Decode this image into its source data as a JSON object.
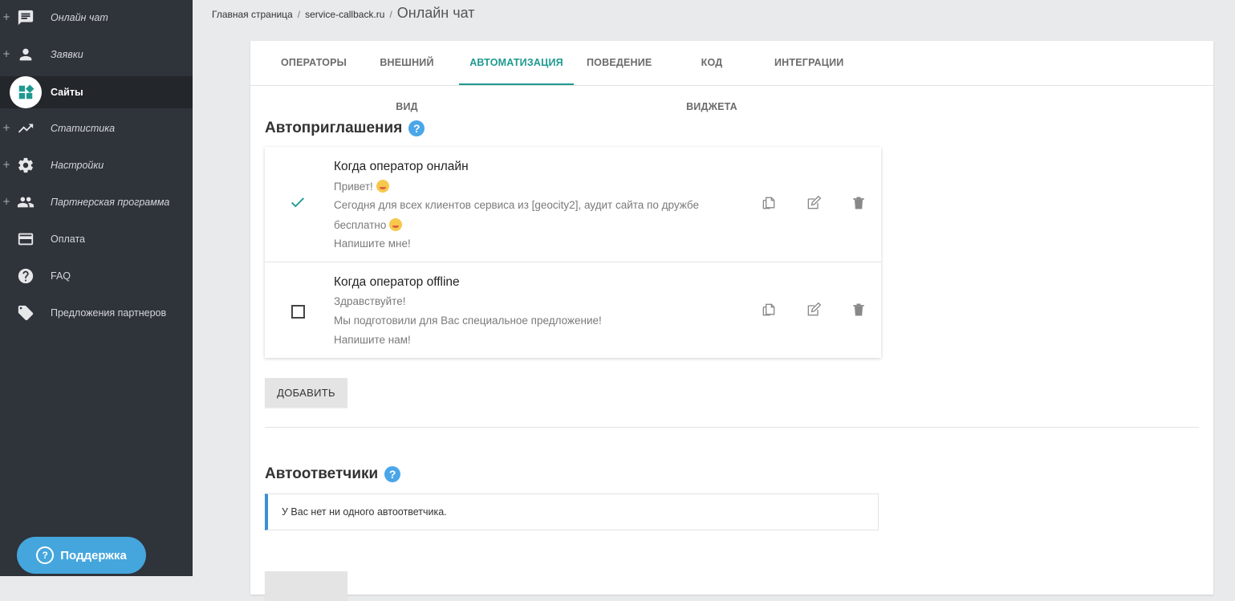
{
  "sidebar": {
    "items": [
      {
        "label": "Онлайн чат",
        "icon": "chat-icon",
        "expandable": "+"
      },
      {
        "label": "Заявки",
        "icon": "person-icon",
        "expandable": "+"
      },
      {
        "label": "Сайты",
        "icon": "sites-icon",
        "expandable": ""
      },
      {
        "label": "Статистика",
        "icon": "trending-up-icon",
        "expandable": "+"
      },
      {
        "label": "Настройки",
        "icon": "gear-icon",
        "expandable": "+"
      },
      {
        "label": "Партнерская программа",
        "icon": "group-icon",
        "expandable": "+"
      },
      {
        "label": "Оплата",
        "icon": "credit-card-icon",
        "expandable": ""
      },
      {
        "label": "FAQ",
        "icon": "help-circle-icon",
        "expandable": ""
      },
      {
        "label": "Предложения партнеров",
        "icon": "tag-icon",
        "expandable": ""
      }
    ],
    "active_item": "Сайты",
    "support_button": "Поддержка"
  },
  "breadcrumb": {
    "home": "Главная страница",
    "site": "service-callback.ru",
    "current": "Онлайн чат",
    "separator": "/"
  },
  "tabs": [
    {
      "label": "ОПЕРАТОРЫ"
    },
    {
      "label": "ВНЕШНИЙ ВИД"
    },
    {
      "label": "АВТОМАТИЗАЦИЯ"
    },
    {
      "label": "ПОВЕДЕНИЕ"
    },
    {
      "label": "КОД ВИДЖЕТА"
    },
    {
      "label": "ИНТЕГРАЦИИ"
    }
  ],
  "active_tab": "АВТОМАТИЗАЦИЯ",
  "autoinvites": {
    "title": "Автоприглашения",
    "items": [
      {
        "title": "Когда оператор онлайн",
        "checked": true,
        "lines": [
          "Привет!",
          "Сегодня для всех клиентов сервиса из [geocity2], аудит сайта по дружбе",
          "бесплатно",
          "Напишите мне!"
        ]
      },
      {
        "title": "Когда оператор offline",
        "checked": false,
        "lines": [
          "Здравствуйте!",
          "Мы подготовили для Вас специальное предложение!",
          "Напишите нам!"
        ]
      }
    ],
    "add_button": "ДОБАВИТЬ"
  },
  "autoresponders": {
    "title": "Автоответчики",
    "empty_text": "У Вас нет ни одного автоответчика."
  },
  "colors": {
    "sidebar_bg": "#2f333a",
    "accent": "#1e9a90",
    "support": "#45a6dd",
    "help": "#4aa6e8",
    "info_border": "#3b8fd6"
  }
}
